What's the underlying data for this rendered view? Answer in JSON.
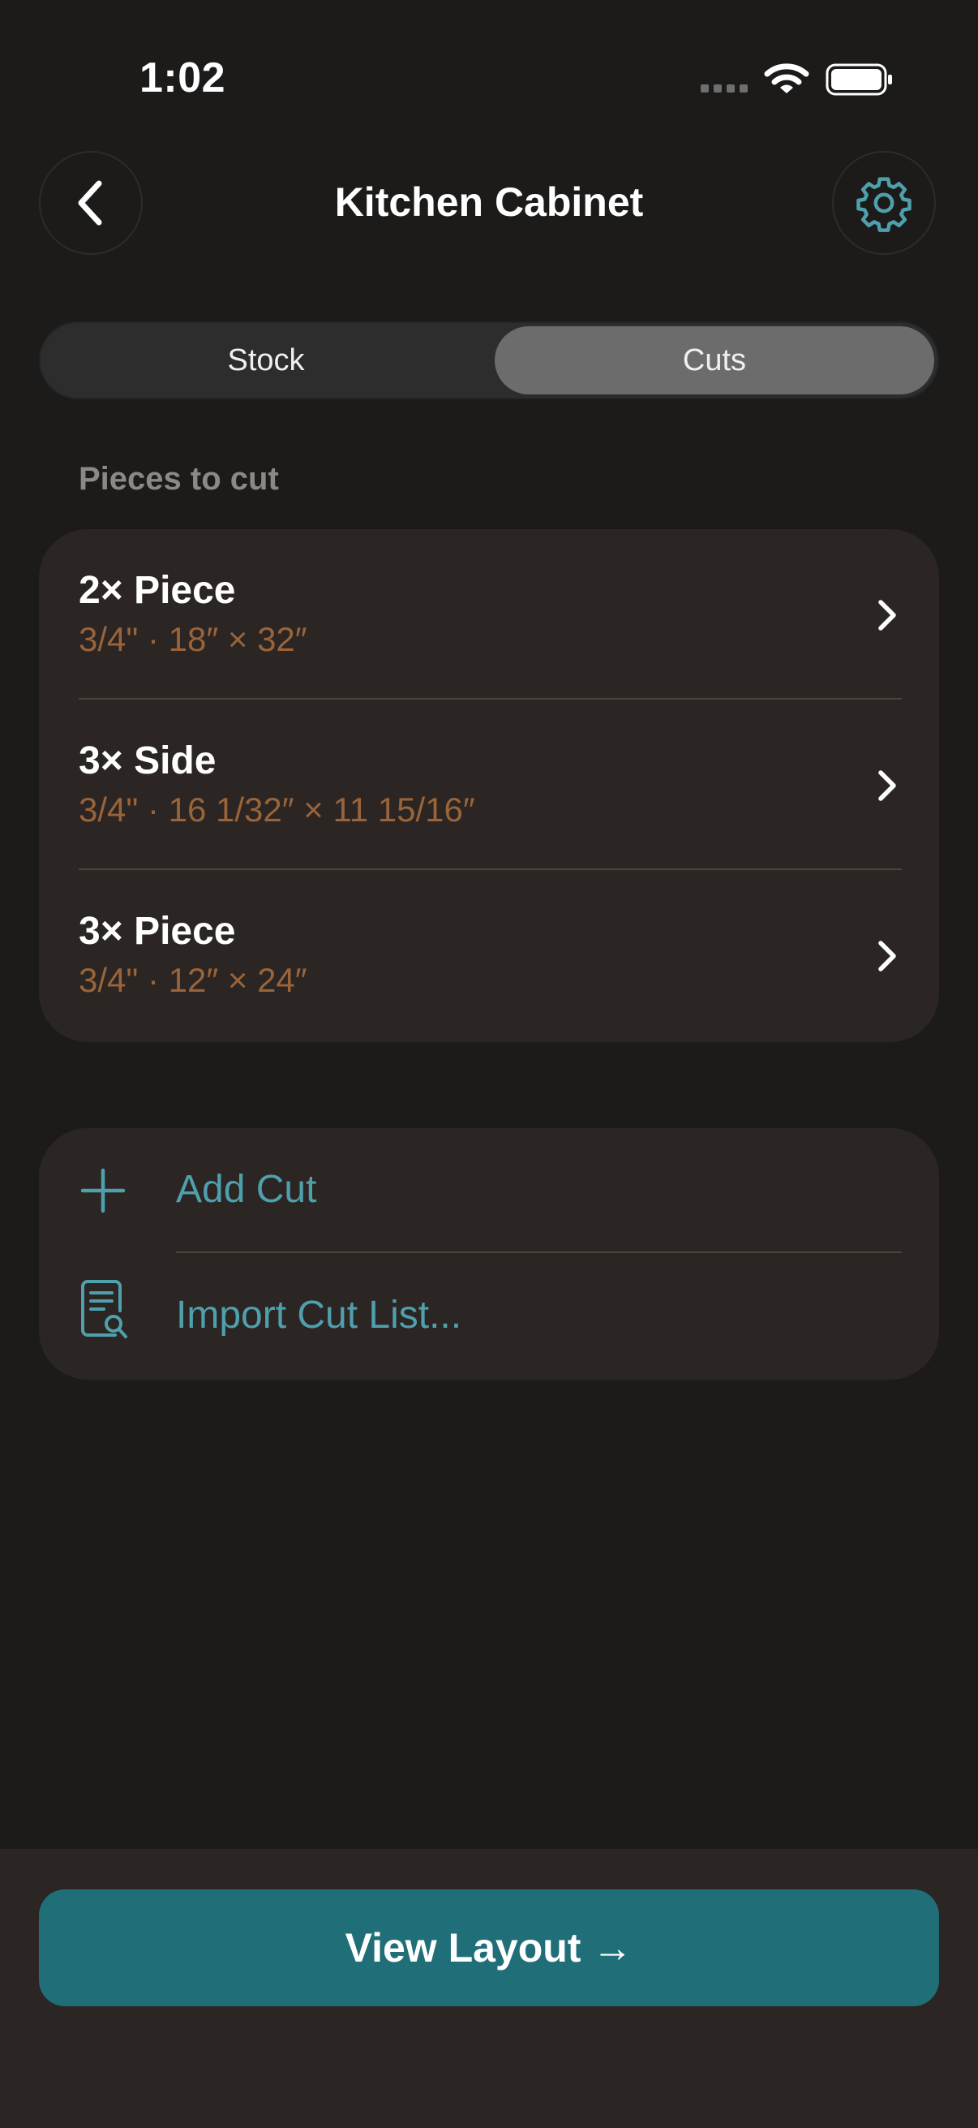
{
  "status_bar": {
    "time": "1:02",
    "signal_icon": "signal-dots-icon",
    "wifi_icon": "wifi-icon",
    "battery_icon": "battery-icon"
  },
  "header": {
    "title": "Kitchen Cabinet",
    "back_icon": "chevron-left-icon",
    "settings_icon": "gear-icon"
  },
  "segments": {
    "options": [
      "Stock",
      "Cuts"
    ],
    "selected": "Cuts"
  },
  "section_label": "Pieces to cut",
  "cuts": [
    {
      "title": "2× Piece",
      "dims": "3/4\" · 18″ × 32″"
    },
    {
      "title": "3× Side",
      "dims": "3/4\" · 16 1/32″ × 11 15/16″"
    },
    {
      "title": "3× Piece",
      "dims": "3/4\" · 12″ × 24″"
    }
  ],
  "actions": {
    "add_cut": "Add Cut",
    "import_cut_list": "Import Cut List..."
  },
  "footer": {
    "view_layout": "View Layout →"
  },
  "colors": {
    "background": "#1c1b1a",
    "card": "#2b2523",
    "accent": "#4fa0ad",
    "dimension_text": "#99643a",
    "primary_button": "#1f6e78"
  }
}
